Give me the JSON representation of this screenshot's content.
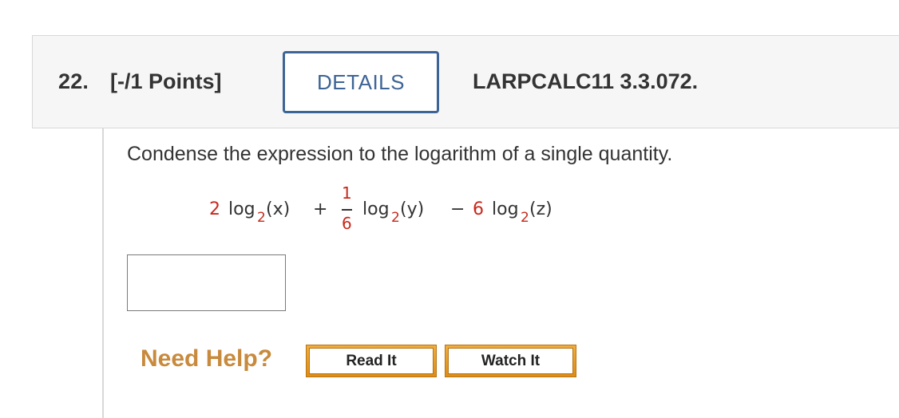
{
  "question": {
    "number": "22.",
    "points": "[-/1 Points]",
    "details_label": "DETAILS",
    "code": "LARPCALC11 3.3.072."
  },
  "prompt": "Condense the expression to the logarithm of a single quantity.",
  "expression": {
    "coef1": "2",
    "log1": "log",
    "base1": "2",
    "arg1": "(x)",
    "plus": "+",
    "frac_num": "1",
    "frac_den": "6",
    "log2": "log",
    "base2": "2",
    "arg2": "(y)",
    "minus": "−",
    "coef3": "6",
    "log3": "log",
    "base3": "2",
    "arg3": "(z)"
  },
  "answer": {
    "value": ""
  },
  "help": {
    "label": "Need Help?",
    "read_it": "Read It",
    "watch_it": "Watch It"
  },
  "colors": {
    "accent_blue": "#3d6496",
    "coefficient_red": "#c8281c",
    "help_orange": "#c88a3c",
    "button_gold": "#e89a22"
  }
}
